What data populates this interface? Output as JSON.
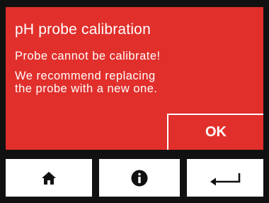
{
  "dialog": {
    "title": "pH probe calibration",
    "message_line1": "Probe cannot be calibrate!",
    "message_line2": "We recommend replacing",
    "message_line3": "the probe with a new one.",
    "ok_label": "OK"
  },
  "navbar": {
    "buttons": [
      {
        "icon": "home-icon"
      },
      {
        "icon": "info-icon"
      },
      {
        "icon": "back-icon"
      }
    ]
  },
  "colors": {
    "dialog_background": "#e12f2b",
    "frame": "#111111",
    "text": "#ffffff",
    "button_background": "#ffffff"
  }
}
